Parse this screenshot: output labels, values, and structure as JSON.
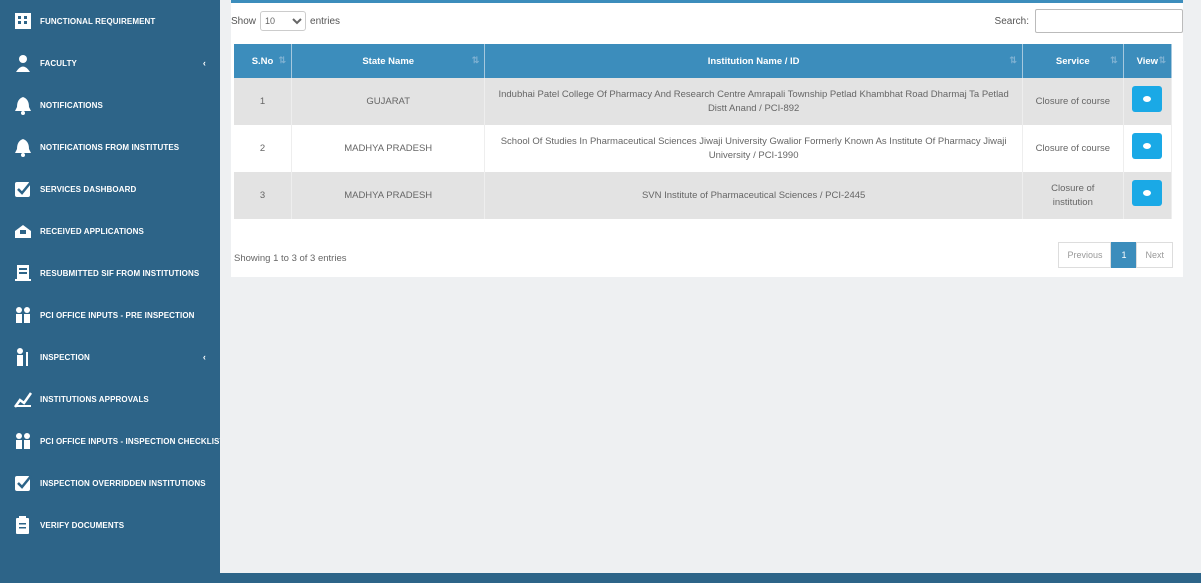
{
  "sidebar": {
    "items": [
      {
        "label": "FUNCTIONAL REQUIREMENT",
        "icon": "building-icon",
        "chevron": ""
      },
      {
        "label": "FACULTY",
        "icon": "person-icon",
        "chevron": "‹"
      },
      {
        "label": "NOTIFICATIONS",
        "icon": "bell-icon",
        "chevron": ""
      },
      {
        "label": "NOTIFICATIONS FROM INSTITUTES",
        "icon": "bell-icon",
        "chevron": ""
      },
      {
        "label": "SERVICES DASHBOARD",
        "icon": "checkbox-icon",
        "chevron": ""
      },
      {
        "label": "RECEIVED APPLICATIONS",
        "icon": "inbox-icon",
        "chevron": ""
      },
      {
        "label": "RESUBMITTED SIF FROM INSTITUTIONS",
        "icon": "document-icon",
        "chevron": ""
      },
      {
        "label": "PCI OFFICE INPUTS - PRE INSPECTION",
        "icon": "people-icon",
        "chevron": ""
      },
      {
        "label": "INSPECTION",
        "icon": "inspector-icon",
        "chevron": "‹"
      },
      {
        "label": "INSTITUTIONS APPROVALS",
        "icon": "chart-icon",
        "chevron": ""
      },
      {
        "label": "PCI OFFICE INPUTS - INSPECTION CHECKLIST",
        "icon": "people-icon",
        "chevron": ""
      },
      {
        "label": "INSPECTION OVERRIDDEN INSTITUTIONS",
        "icon": "checkbox-icon",
        "chevron": ""
      },
      {
        "label": "VERIFY DOCUMENTS",
        "icon": "clipboard-icon",
        "chevron": ""
      }
    ]
  },
  "controls": {
    "show_label": "Show",
    "page_size": "10",
    "entries_label": "entries",
    "search_label": "Search:"
  },
  "table": {
    "headers": [
      "S.No",
      "State Name",
      "Institution Name / ID",
      "Service",
      "View"
    ],
    "rows": [
      {
        "sno": "1",
        "state": "GUJARAT",
        "institution": "Indubhai Patel College Of Pharmacy And Research Centre Amrapali Township Petlad Khambhat Road Dharmaj Ta Petlad Distt Anand / PCI-892",
        "service": "Closure of course"
      },
      {
        "sno": "2",
        "state": "MADHYA PRADESH",
        "institution": "School Of Studies In Pharmaceutical Sciences Jiwaji University Gwalior Formerly Known As Institute Of Pharmacy Jiwaji University / PCI-1990",
        "service": "Closure of course"
      },
      {
        "sno": "3",
        "state": "MADHYA PRADESH",
        "institution": "SVN Institute of Pharmaceutical Sciences / PCI-2445",
        "service": "Closure of institution"
      }
    ]
  },
  "footer": {
    "info": "Showing 1 to 3 of 3 entries",
    "previous": "Previous",
    "current_page": "1",
    "next": "Next"
  },
  "colors": {
    "sidebar": "#2d6488",
    "header": "#3c8dbc",
    "view_button": "#1aa9e6"
  }
}
